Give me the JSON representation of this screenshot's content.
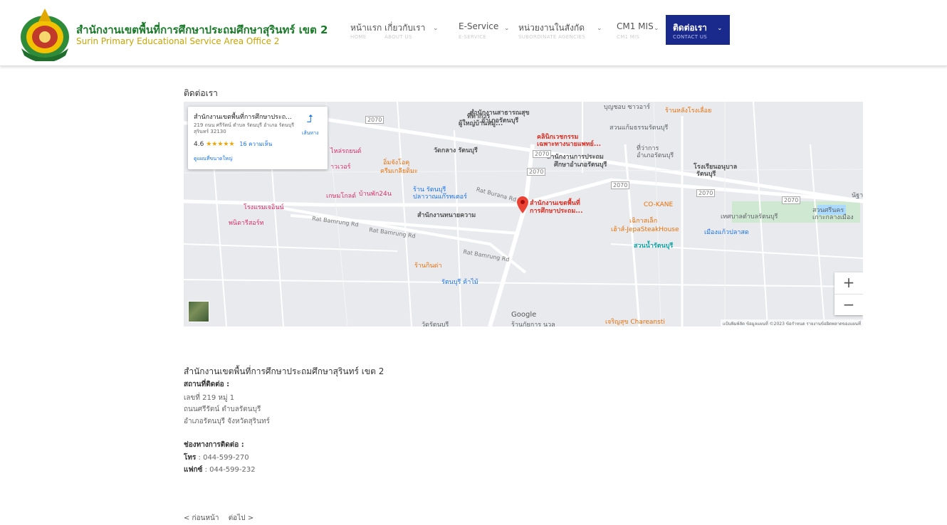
{
  "header": {
    "title_th": "สำนักงานเขตพื้นที่การศึกษาประถมศึกษาสุรินทร์ เขต 2",
    "title_en": "Surin Primary Educational Service Area Office 2",
    "nav": [
      {
        "label": "หน้าแรก",
        "sub": "HOME"
      },
      {
        "label": "เกี่ยวกับเรา",
        "sub": "ABOUT US"
      },
      {
        "label": "E-Service",
        "sub": "E-SERVICE"
      },
      {
        "label": "หน่วยงานในสังกัด",
        "sub": "SUBORDINATE AGENCIES"
      },
      {
        "label": "CM1 MIS",
        "sub": "CM1 MIS"
      },
      {
        "label": "ติดต่อเรา",
        "sub": "CONTACT US"
      }
    ],
    "active_color": "#1a2a8c"
  },
  "page": {
    "heading": "ติดต่อเรา"
  },
  "map": {
    "card": {
      "title": "สำนักงานเขตพื้นที่การศึกษาประถ...",
      "address": "219 ถนน ศรีรัตน์ ตำบล รัตนบุรี อำเภอ รัตนบุรี สุรินทร์ 32130",
      "rating": "4.6",
      "stars": "★★★★★",
      "reviews": "16 ความเห็น",
      "bigmap": "ดูแผนที่ขนาดใหญ่",
      "directions": "เส้นทาง"
    },
    "labels": {
      "l1": "ที่ทำการ",
      "l2": "ผู้ใหญ่บ้านหมู่...",
      "l3": "สำนักงานสาธารณสุข",
      "l4": "อำเภอรัตนบุรี",
      "l5": "บุญชอบ ซาวอาร์",
      "l6": "ร้านหลังโรงเลื่อย",
      "l7": "คลินิกเวชกรรม",
      "l8": "เฉพาะทางนายแพทย์...",
      "l9": "สวนแก้มธรรมรัตนบุรี",
      "l10": "วัดกลาง รัตนบุรี",
      "l11": "สำนักงานการประถม",
      "l12": "ศึกษาอำเภอรัตนบุรี",
      "l13": "ที่ว่าการ",
      "l14": "อำเภอรัตนบุรี",
      "l15": "โรงเรียนอนุบาล",
      "l16": "รัตนบุรี",
      "l17": "ไหล่รถยนต์",
      "l18": "าวเวอร์",
      "l19": "อิ่มจังโอคุ",
      "l20": "ครีมเกลียดิมะ",
      "l21": "ร้าน รัตนบุรี",
      "l22": "ปลาวาณแก๊รทเตอร์",
      "l23": "โรงแรมเจอินน์",
      "l24": "เกษมโกลด์",
      "l25": "บ้านพัก24น",
      "l26": "Rat Burana Rd",
      "l27": "สำนักงานเขตพื้นที่",
      "l28": "การศึกษาประถม...",
      "l29": "สำนักงานทนายความ",
      "l30": "CO-KANE",
      "l31": "เทศบาลตำบลรัตนบุรี",
      "l32": "สวนศรีนคร",
      "l33": "เกาะกลางเมือง",
      "l34": "พนิดารีสอร์ท",
      "l35": "Rat Bamrung Rd",
      "l36": "Rat Bamrung Rd",
      "l37": "เฉิกาสเล็ก",
      "l38": "เฮ้าส์-JepaSteakHouse",
      "l39": "เมืองแก้วปลาสด",
      "l40": "สวนน้ำรัตนบุรี",
      "l41": "Rat Bamrung Rd",
      "l42": "ร้านกินด่า",
      "l43": "รัตนบุรี ค้าไม้",
      "l44": "วัดรัตนบุรี",
      "l45": "ร้านกัยการ นวล",
      "l46": "เจริญสุข Chareansti",
      "l47": "นัฐา",
      "r1": "2070",
      "r2": "2070",
      "r3": "2070",
      "r4": "2070",
      "r5": "2070",
      "r6": "2070"
    },
    "google": "Google",
    "footer": "แป้นพิมพ์ลัด   ข้อมูลแผนที่ ©2023   ข้อกำหนด   รายงานข้อผิดพลาดของแผนที่",
    "zoom_in": "+",
    "zoom_out": "−"
  },
  "contact": {
    "org_name": "สำนักงานเขตพื้นที่การศึกษาประถมศึกษาสุรินทร์ เขต 2",
    "address_label": "สถานที่ติดต่อ :",
    "address_lines": [
      "เลขที่ 219 หมู่ 1",
      "ถนนศรีรัตน์ ตำบลรัตนบุรี",
      "อำเภอรัตนบุรี จังหวัดสุรินทร์"
    ],
    "channel_label": "ช่องทางการติดต่อ :",
    "phone_label": "โทร",
    "phone": ": 044-599-270",
    "fax_label": "แฟกซ์",
    "fax": ": 044-599-232"
  },
  "pager": {
    "prev": "< ก่อนหน้า",
    "next": "ต่อไป >"
  }
}
